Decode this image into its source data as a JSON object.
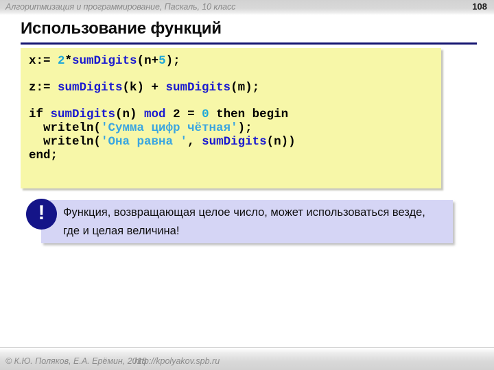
{
  "header": {
    "subject": "Алгоритмизация и программирование, Паскаль, 10 класс",
    "page_number": "108"
  },
  "title": "Использование функций",
  "code": {
    "lines": [
      {
        "tokens": [
          {
            "text": "x:= ",
            "color": "black"
          },
          {
            "text": "2",
            "color": "cyan"
          },
          {
            "text": "*",
            "color": "black"
          },
          {
            "text": "sumDigits",
            "color": "blue"
          },
          {
            "text": "(n+",
            "color": "black"
          },
          {
            "text": "5",
            "color": "cyan"
          },
          {
            "text": ");",
            "color": "black"
          }
        ],
        "gap": true
      },
      {
        "tokens": [
          {
            "text": "z:= ",
            "color": "black"
          },
          {
            "text": "sumDigits",
            "color": "blue"
          },
          {
            "text": "(k) + ",
            "color": "black"
          },
          {
            "text": "sumDigits",
            "color": "blue"
          },
          {
            "text": "(m);",
            "color": "black"
          }
        ],
        "gap": true
      },
      {
        "tokens": [
          {
            "text": "if ",
            "color": "black"
          },
          {
            "text": "sumDigits",
            "color": "blue"
          },
          {
            "text": "(n) ",
            "color": "black"
          },
          {
            "text": "mod",
            "color": "blue"
          },
          {
            "text": " 2 = ",
            "color": "black"
          },
          {
            "text": "0",
            "color": "cyan"
          },
          {
            "text": " then begin",
            "color": "black"
          }
        ],
        "gap": false
      },
      {
        "tokens": [
          {
            "text": "  writeln(",
            "color": "black"
          },
          {
            "text": "'Сумма цифр чётная'",
            "color": "str"
          },
          {
            "text": ");",
            "color": "black"
          }
        ],
        "gap": false
      },
      {
        "tokens": [
          {
            "text": "  writeln(",
            "color": "black"
          },
          {
            "text": "'Она равна '",
            "color": "str"
          },
          {
            "text": ", ",
            "color": "black"
          },
          {
            "text": "sumDigits",
            "color": "blue"
          },
          {
            "text": "(n))",
            "color": "black"
          }
        ],
        "gap": false
      },
      {
        "tokens": [
          {
            "text": "end;",
            "color": "black"
          }
        ],
        "gap": false
      }
    ]
  },
  "callout": {
    "badge": "!",
    "text": "Функция, возвращающая целое число, может использоваться везде, где и целая величина!"
  },
  "footer": {
    "copyright": "© К.Ю. Поляков, Е.А. Ерёмин, 2018",
    "url": "http://kpolyakov.spb.ru"
  },
  "colors": {
    "accent_rule": "#141470",
    "code_bg": "#f7f7a8",
    "callout_bg": "#d5d5f5",
    "badge_bg": "#141488",
    "keyword_blue": "#1a1ad0",
    "number_cyan": "#1fa8d8",
    "string_cyan": "#3ba6e0"
  }
}
